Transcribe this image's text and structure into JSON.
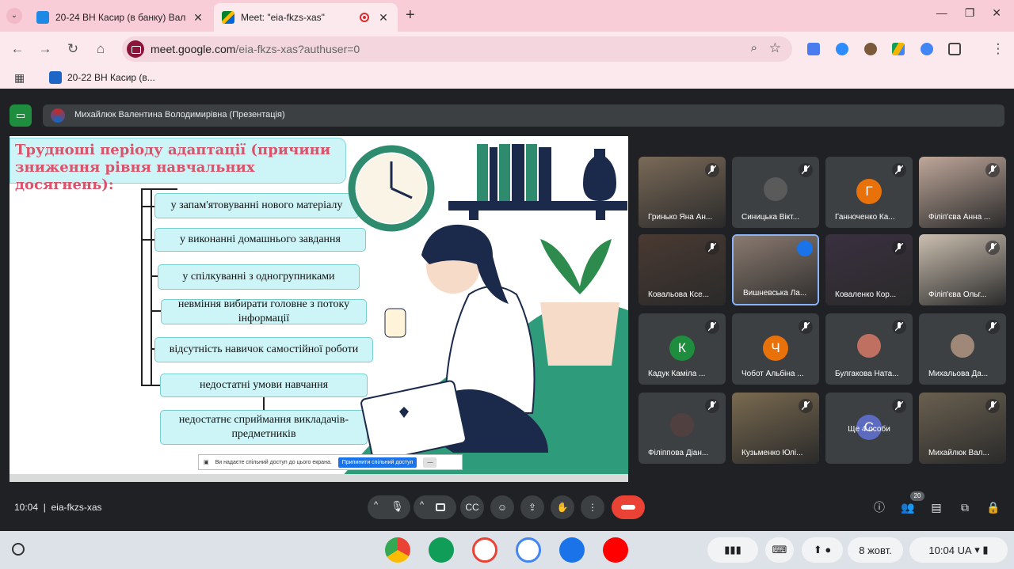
{
  "browser": {
    "tabs": [
      {
        "title": "20-24 ВН Касир (в банку) Вал",
        "active": false
      },
      {
        "title": "Meet: \"eia-fkzs-xas\"",
        "active": true
      }
    ],
    "url_host": "meet.google.com",
    "url_path": "/eia-fkzs-xas?authuser=0",
    "bookmark": "20-22 ВН Касир (в..."
  },
  "meet": {
    "presenter_banner": "Михайлюк Валентина Володимирівна (Презентація)",
    "meeting_time": "10:04",
    "meeting_code": "eia-fkzs-xas",
    "participant_count": "20",
    "tiles": [
      {
        "name": "Гринько Яна Ан..."
      },
      {
        "name": "Синицька Вікт..."
      },
      {
        "name": "Ганноченко Ка...",
        "letter": "Г"
      },
      {
        "name": "Філіп'єва Анна ..."
      },
      {
        "name": "Ковальова Ксе..."
      },
      {
        "name": "Вишневська Ла..."
      },
      {
        "name": "Коваленко Кор..."
      },
      {
        "name": "Філіп'єва Ольг..."
      },
      {
        "name": "Кадук Каміла ...",
        "letter": "К"
      },
      {
        "name": "Чобот Альбіна ...",
        "letter": "Ч"
      },
      {
        "name": "Булгакова Ната..."
      },
      {
        "name": "Михальова Да..."
      },
      {
        "name": "Філіппова Діан..."
      },
      {
        "name": "Кузьменко Юлі..."
      },
      {
        "name": "Ще 4 особи",
        "letter": "С"
      },
      {
        "name": "Михайлюк Вал..."
      }
    ]
  },
  "slide": {
    "title": "Трудноші періоду адаптації (причини зниження рівня навчальних досягнень):",
    "causes": [
      "у запам'ятовуванні нового матеріалу",
      "у виконанні домашнього завдання",
      "у спілкуванні з одногрупниками",
      "невміння вибирати головне з потоку інформації",
      "відсутність навичок самостійної роботи",
      "недостатні умови навчання",
      "недостатнє сприймання викладачів-предметників"
    ],
    "share_text": "Ви надаєте спільний доступ до цього екрана.",
    "share_stop": "Припинити спільний доступ",
    "share_hide": "—"
  },
  "shelf": {
    "date": "8 жовт.",
    "time": "10:04",
    "lang": "UA"
  },
  "colors": {
    "title_text": "#d9536b",
    "box_fill": "#cdf5f7",
    "leave": "#ea4335",
    "tab_bg": "#f9cdd8"
  }
}
